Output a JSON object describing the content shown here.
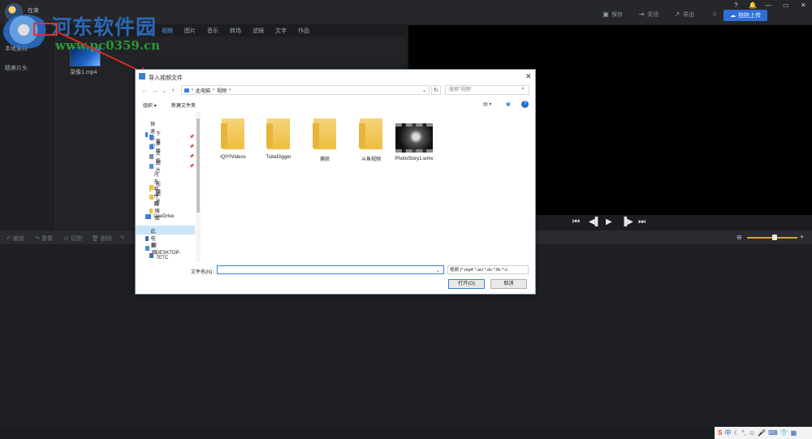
{
  "app": {
    "username": "在来",
    "toolbar": {
      "save": "保存",
      "close": "关闭",
      "export": "导出",
      "upload": "拍拍上传"
    },
    "window_controls": [
      "?",
      "🔔",
      "—",
      "▭",
      "✕"
    ]
  },
  "watermark": {
    "title": "河东软件园",
    "url": "www.pc0359.cn"
  },
  "left_nav": {
    "items": [
      "本地素材",
      "精美片头"
    ]
  },
  "tabs": [
    "视频",
    "图片",
    "音乐",
    "转场",
    "滤镜",
    "文字",
    "作品"
  ],
  "active_tab_index": 0,
  "media": {
    "items": [
      {
        "name": "录像1.mp4"
      }
    ]
  },
  "edit_toolbar": [
    "撤销",
    "重做",
    "切割",
    "删除"
  ],
  "player": {
    "zoom_level": 0.55
  },
  "dialog": {
    "title": "导入视频文件",
    "address": [
      "此电脑",
      "视频"
    ],
    "search_placeholder": "搜索\"视频\"",
    "organize": "组织 ▾",
    "new_folder": "新建文件夹",
    "sidebar": [
      {
        "label": "快速访问",
        "icon": "star-icon"
      },
      {
        "label": "下载",
        "icon": "download-icon",
        "pinned": true
      },
      {
        "label": "桌面",
        "icon": "desktop-icon",
        "pinned": true
      },
      {
        "label": "文档",
        "icon": "document-icon",
        "pinned": true
      },
      {
        "label": "图片",
        "icon": "picture-icon",
        "pinned": true
      },
      {
        "label": "河东软件园",
        "icon": "folder-icon"
      },
      {
        "label": "视频",
        "icon": "folder-icon"
      },
      {
        "label": "图片",
        "icon": "folder-icon"
      },
      {
        "label": "压缩图",
        "icon": "folder-icon"
      },
      {
        "label": "OneDrive",
        "icon": "cloud-icon"
      },
      {
        "label": "此电脑",
        "icon": "computer-icon",
        "selected": true
      },
      {
        "label": "网络",
        "icon": "network-icon"
      },
      {
        "label": "DESKTOP-7ETC",
        "icon": "computer-icon"
      }
    ],
    "files": [
      {
        "name": "iQIYIVideos",
        "type": "folder"
      },
      {
        "name": "TubeDigger",
        "type": "folder"
      },
      {
        "name": "捕获",
        "type": "folder"
      },
      {
        "name": "斗鱼视频",
        "type": "folder"
      },
      {
        "name": "PhotoStory1.wmv",
        "type": "video"
      }
    ],
    "filename_label": "文件名(N):",
    "filename_value": "",
    "filter": "视频 (*.mp4 *.avi *.dv *.flv *.n",
    "open": "打开(O)",
    "cancel": "取消"
  },
  "colors": {
    "accent": "#2e6fd8",
    "active_tab": "#5aa0ff",
    "annotation": "#e03030"
  }
}
